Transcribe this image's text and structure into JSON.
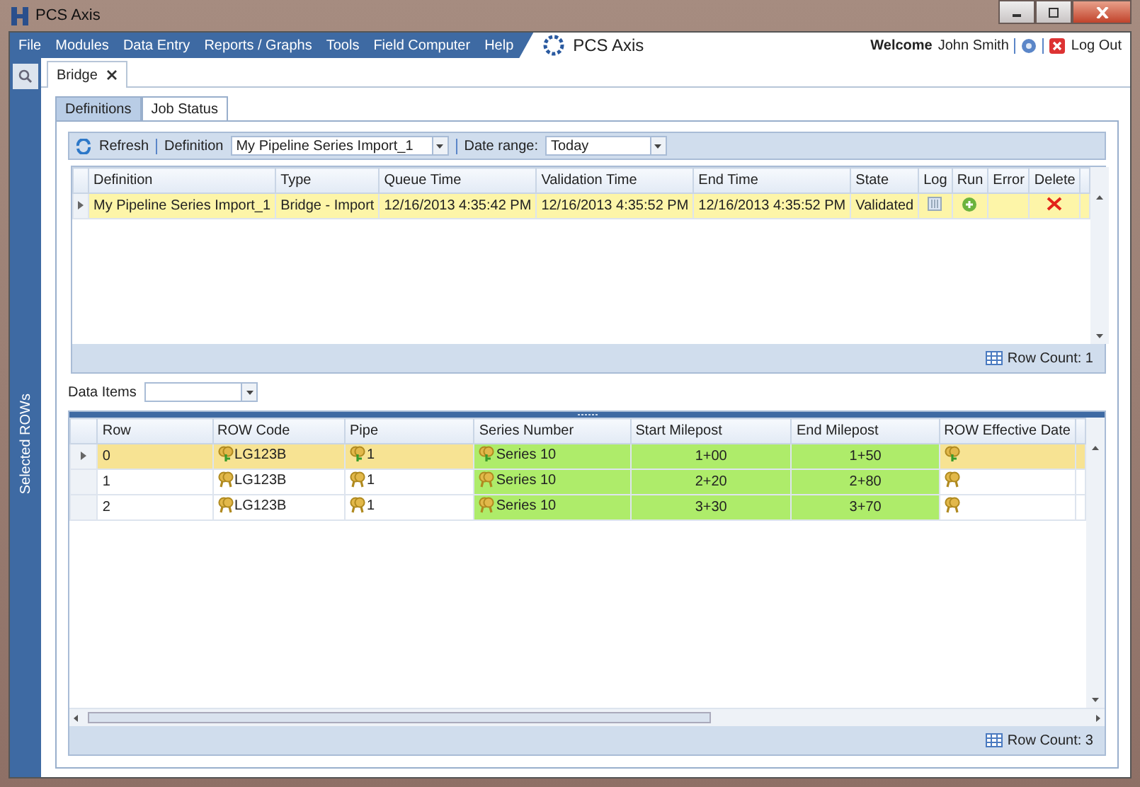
{
  "window": {
    "title": "PCS Axis"
  },
  "menu": [
    "File",
    "Modules",
    "Data Entry",
    "Reports / Graphs",
    "Tools",
    "Field Computer",
    "Help"
  ],
  "app_title": "PCS Axis",
  "user": {
    "welcome": "Welcome",
    "name": "John Smith",
    "logout": "Log Out"
  },
  "sidebar": {
    "label": "Selected ROWs"
  },
  "doc_tabs": [
    {
      "label": "Bridge",
      "selected": true
    }
  ],
  "tabs": [
    {
      "label": "Definitions",
      "selected": false
    },
    {
      "label": "Job Status",
      "selected": true
    }
  ],
  "toolbar": {
    "refresh": "Refresh",
    "definition_label": "Definition",
    "definition_value": "My Pipeline Series Import_1",
    "date_label": "Date range:",
    "date_value": "Today"
  },
  "jobs": {
    "columns": [
      "Definition",
      "Type",
      "Queue Time",
      "Validation Time",
      "End Time",
      "State",
      "Log",
      "Run",
      "Error",
      "Delete"
    ],
    "rows": [
      {
        "selected": true,
        "cells": [
          "My Pipeline Series Import_1",
          "Bridge - Import",
          "12/16/2013 4:35:42 PM",
          "12/16/2013 4:35:52 PM",
          "12/16/2013 4:35:52 PM",
          "Validated"
        ]
      }
    ],
    "row_count": "Row Count: 1"
  },
  "data_items": {
    "label": "Data Items"
  },
  "items": {
    "columns": [
      {
        "label": "Row",
        "highlighted": false
      },
      {
        "label": "ROW Code",
        "highlighted": false
      },
      {
        "label": "Pipe",
        "highlighted": false
      },
      {
        "label": "Series Number",
        "highlighted": true
      },
      {
        "label": "Start Milepost",
        "highlighted": true
      },
      {
        "label": "End Milepost",
        "highlighted": true
      },
      {
        "label": "ROW Effective Date",
        "highlighted": false
      }
    ],
    "rows": [
      {
        "selected": true,
        "cells": [
          "0",
          "LG123B",
          "1",
          "Series 10",
          "1+00",
          "1+50",
          ""
        ]
      },
      {
        "selected": false,
        "cells": [
          "1",
          "LG123B",
          "1",
          "Series 10",
          "2+20",
          "2+80",
          ""
        ]
      },
      {
        "selected": false,
        "cells": [
          "2",
          "LG123B",
          "1",
          "Series 10",
          "3+30",
          "3+70",
          ""
        ]
      }
    ],
    "row_count": "Row Count: 3"
  }
}
